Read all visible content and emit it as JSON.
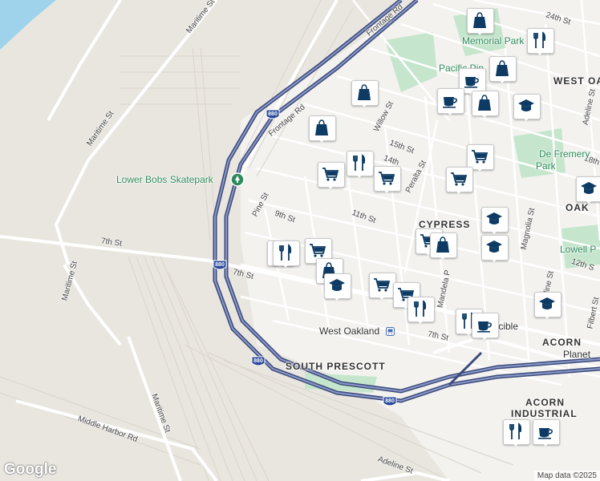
{
  "map": {
    "google_logo": "Google",
    "attribution": "Map data ©2025",
    "colors": {
      "land": "#e9e6e0",
      "urban": "#f3f2ef",
      "water": "#9fd3ec",
      "park": "#c5e6cd",
      "freeway": "#3b4a7a",
      "marker_icon": "#0d3b63"
    },
    "freeway_shields": [
      "880",
      "880",
      "880",
      "880"
    ],
    "labels": {
      "maritime_1": "Maritime St",
      "maritime_2": "Maritime St",
      "maritime_3": "Maritime St",
      "maritime_4": "Maritime St",
      "frontage_1": "Frontage Rd",
      "frontage_2": "Frontage Rd",
      "seventh_1": "7th St",
      "seventh_2": "7th St",
      "seventh_3": "7th St",
      "middle_harbor": "Middle Harbor Rd",
      "pine": "Pine St",
      "ninth": "9th St",
      "eleventh": "11th St",
      "fifteenth": "15th St",
      "fourteenth": "14th",
      "willow": "Willow St",
      "peralta": "Peralta St",
      "twenty_fourth": "24th St",
      "eighteenth": "18th",
      "twelfth": "12th S",
      "magnolia": "Magnolia St",
      "adeline_1": "Adeline St",
      "adeline_2": "Adeline St",
      "adeline_3": "Adeline St",
      "filbert": "Filbert St",
      "mandela": "Mandela P",
      "skatepark": "Lower Bobs Skatepark",
      "memorial_park": "Memorial Park",
      "pacific_pipe": "Pacific Pip",
      "de_fremery_1": "De Fremery",
      "de_fremery_2": "Park",
      "lowell_park": "Lowell P",
      "west_oakland_station": "West Oakland",
      "crucible": "Crucible",
      "planet": "Planet",
      "west_oak": "WEST OA",
      "cypress": "CYPRESS",
      "oak": "OAK",
      "south_prescott": "SOUTH PRESCOTT",
      "acorn": "ACORN",
      "acorn_industrial_1": "ACORN",
      "acorn_industrial_2": "INDUSTRIAL"
    },
    "markers": [
      {
        "icon": "shopping-bag-icon"
      },
      {
        "icon": "fork-knife-icon"
      },
      {
        "icon": "shopping-bag-icon"
      },
      {
        "icon": "coffee-cup-icon"
      },
      {
        "icon": "shopping-bag-icon"
      },
      {
        "icon": "graduation-cap-icon"
      },
      {
        "icon": "shopping-bag-icon"
      },
      {
        "icon": "shopping-bag-icon"
      },
      {
        "icon": "coffee-cup-icon"
      },
      {
        "icon": "shopping-cart-icon"
      },
      {
        "icon": "fork-knife-icon"
      },
      {
        "icon": "shopping-cart-icon"
      },
      {
        "icon": "shopping-cart-icon"
      },
      {
        "icon": "shopping-cart-icon"
      },
      {
        "icon": "graduation-cap-icon"
      },
      {
        "icon": "graduation-cap-icon"
      },
      {
        "icon": "shopping-cart-icon"
      },
      {
        "icon": "shopping-bag-icon"
      },
      {
        "icon": "graduation-cap-icon"
      },
      {
        "icon": "fork-knife-icon"
      },
      {
        "icon": "shopping-cart-icon"
      },
      {
        "icon": "shopping-bag-icon"
      },
      {
        "icon": "graduation-cap-icon"
      },
      {
        "icon": "shopping-cart-icon"
      },
      {
        "icon": "shopping-cart-icon"
      },
      {
        "icon": "fork-knife-icon"
      },
      {
        "icon": "fork-knife-icon"
      },
      {
        "icon": "fork-knife-icon"
      },
      {
        "icon": "graduation-cap-icon"
      },
      {
        "icon": "coffee-cup-icon"
      },
      {
        "icon": "fork-knife-icon"
      },
      {
        "icon": "coffee-cup-icon"
      }
    ]
  }
}
